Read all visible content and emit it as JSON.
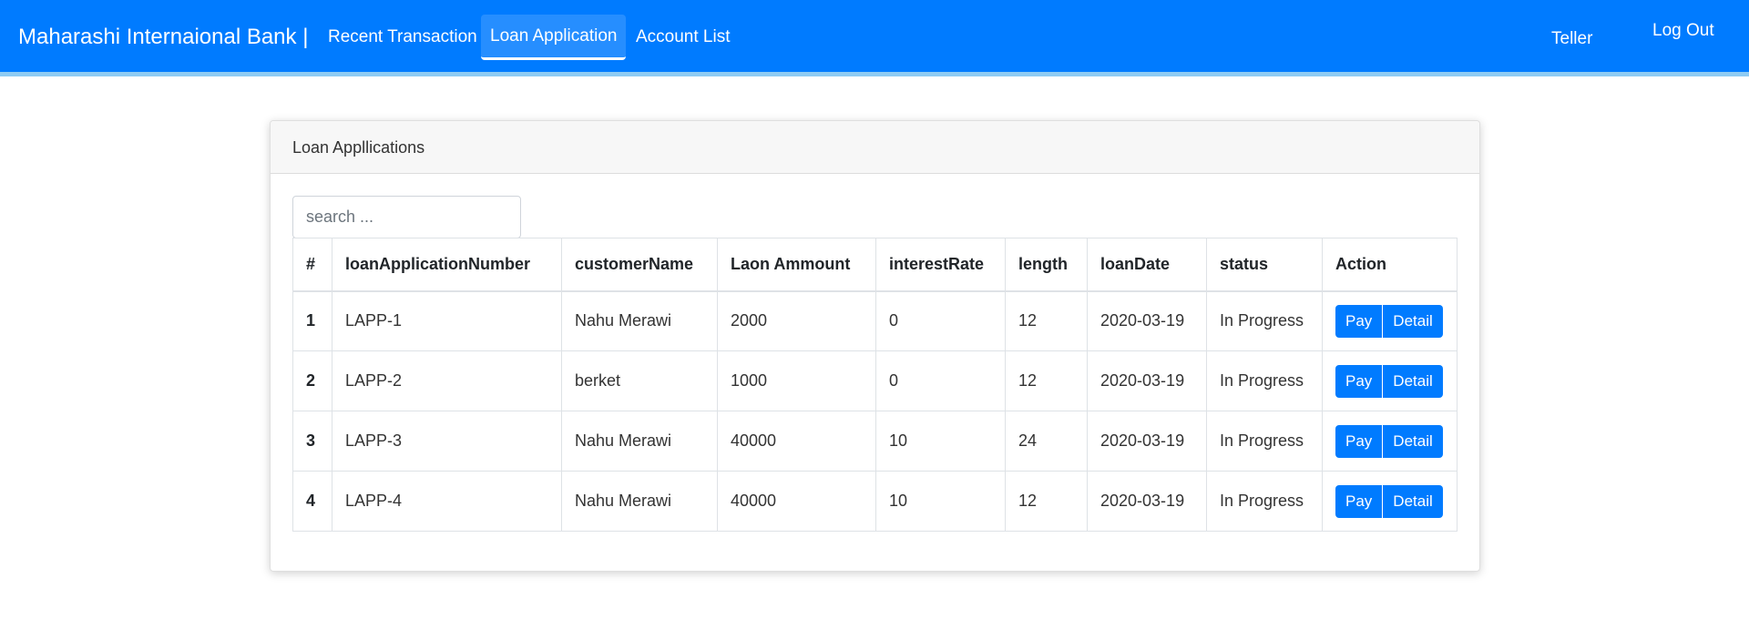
{
  "navbar": {
    "brand": "Maharashi Internaional Bank |",
    "items": [
      {
        "label": "Recent Transaction",
        "active": false
      },
      {
        "label": "Loan Application",
        "active": true
      },
      {
        "label": "Account List",
        "active": false
      }
    ],
    "role": "Teller",
    "logout_label": "Log Out"
  },
  "colors": {
    "primary": "#007bff",
    "nav_accent": "#8ecbf3"
  },
  "card": {
    "title": "Loan Appllications",
    "search_placeholder": "search ...",
    "table": {
      "headers": [
        "#",
        "loanApplicationNumber",
        "customerName",
        "Laon Ammount",
        "interestRate",
        "length",
        "loanDate",
        "status",
        "Action"
      ],
      "rows": [
        {
          "num": "1",
          "loanApplicationNumber": "LAPP-1",
          "customerName": "Nahu Merawi",
          "amount": "2000",
          "interestRate": "0",
          "length": "12",
          "loanDate": "2020-03-19",
          "status": "In Progress"
        },
        {
          "num": "2",
          "loanApplicationNumber": "LAPP-2",
          "customerName": "berket",
          "amount": "1000",
          "interestRate": "0",
          "length": "12",
          "loanDate": "2020-03-19",
          "status": "In Progress"
        },
        {
          "num": "3",
          "loanApplicationNumber": "LAPP-3",
          "customerName": "Nahu Merawi",
          "amount": "40000",
          "interestRate": "10",
          "length": "24",
          "loanDate": "2020-03-19",
          "status": "In Progress"
        },
        {
          "num": "4",
          "loanApplicationNumber": "LAPP-4",
          "customerName": "Nahu Merawi",
          "amount": "40000",
          "interestRate": "10",
          "length": "12",
          "loanDate": "2020-03-19",
          "status": "In Progress"
        }
      ],
      "pay_label": "Pay",
      "detail_label": "Detail"
    }
  }
}
